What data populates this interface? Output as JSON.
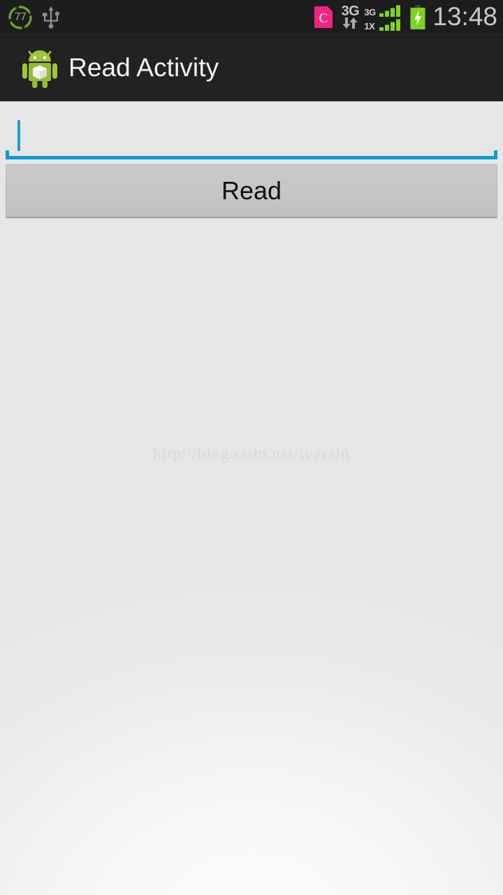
{
  "status_bar": {
    "background_color": "#1d1d1d",
    "left_icons": [
      {
        "name": "battery-percent-badge",
        "value": "77",
        "ring_color": "#5a8a2a",
        "text_color": "#9aa892"
      },
      {
        "name": "usb-icon",
        "color": "#8e8e8e"
      }
    ],
    "notification_icon": {
      "name": "c-app-notification-icon",
      "letter": "C",
      "color": "#f0257f"
    },
    "network": {
      "label": "3G",
      "data_arrows": "down-up",
      "signals": [
        {
          "label": "3G",
          "bars_filled": 4,
          "bars_total": 4
        },
        {
          "label": "1X",
          "bars_filled": 4,
          "bars_total": 4
        }
      ],
      "signal_color": "#7ed321"
    },
    "battery": {
      "charging": true,
      "color": "#7ed321",
      "icon": "battery-charging-icon"
    },
    "clock": "13:48"
  },
  "action_bar": {
    "background_color": "#222222",
    "logo": {
      "name": "android-robot-logo",
      "body_color": "#a4c639",
      "emblem": "white-cube"
    },
    "title": "Read Activity"
  },
  "content": {
    "background_color": "#ececec",
    "input": {
      "value": "",
      "placeholder": "",
      "focused": true,
      "accent_color": "#0d9dd4",
      "caret_visible": true
    },
    "read_button": {
      "label": "Read",
      "enabled": true,
      "background_color": "#c6c6c6",
      "text_color": "#101010"
    },
    "watermark": "http://blog.csdn.net/iverain"
  }
}
